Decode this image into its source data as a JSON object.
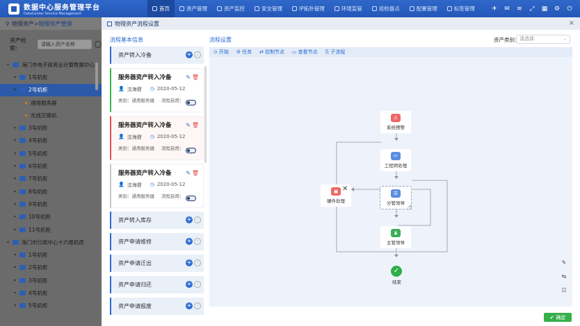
{
  "app": {
    "title": "数据中心服务管理平台",
    "subtitle": "DataCenter Service Management"
  },
  "nav": [
    {
      "label": "首页",
      "icon": "home-icon"
    },
    {
      "label": "资产管理",
      "icon": "asset-icon"
    },
    {
      "label": "资产监控",
      "icon": "monitor-icon"
    },
    {
      "label": "安全管理",
      "icon": "shield-icon"
    },
    {
      "label": "IP拓扑管理",
      "icon": "topology-icon"
    },
    {
      "label": "环境监管",
      "icon": "environment-icon"
    },
    {
      "label": "巡检盘点",
      "icon": "inspection-icon"
    },
    {
      "label": "配置管理",
      "icon": "config-icon"
    },
    {
      "label": "标签管理",
      "icon": "tag-icon"
    }
  ],
  "bg": {
    "breadcrumb": {
      "root": "物理资产",
      "sep": ">",
      "current": "物理资产管理"
    },
    "search_label": "资产检索:",
    "search_placeholder": "请输入资产名称",
    "tree": [
      {
        "label": "海门市电子政务云计算数据中心",
        "level": 0
      },
      {
        "label": "1号机柜",
        "level": 1
      },
      {
        "label": "2号机柜",
        "level": 1,
        "selected": true
      },
      {
        "label": "通用服务器",
        "level": 2
      },
      {
        "label": "光线交换机",
        "level": 2
      },
      {
        "label": "3号机柜",
        "level": 1
      },
      {
        "label": "4号机柜",
        "level": 1
      },
      {
        "label": "5号机柜",
        "level": 1
      },
      {
        "label": "6号机柜",
        "level": 1
      },
      {
        "label": "7号机柜",
        "level": 1
      },
      {
        "label": "8号机柜",
        "level": 1
      },
      {
        "label": "9号机柜",
        "level": 1
      },
      {
        "label": "10号机柜",
        "level": 1
      },
      {
        "label": "11号机柜",
        "level": 1
      },
      {
        "label": "海门市行政中心十六楼机房",
        "level": 0
      },
      {
        "label": "1号机柜",
        "level": 1
      },
      {
        "label": "2号机柜",
        "level": 1
      },
      {
        "label": "3号机柜",
        "level": 1
      },
      {
        "label": "4号机柜",
        "level": 1
      },
      {
        "label": "5号机柜",
        "level": 1
      }
    ]
  },
  "modal": {
    "title": "物理资产流程设置",
    "left_title": "流程基本信息",
    "right_title": "流程设置",
    "type_label": "资产类别：",
    "type_placeholder": "请选择",
    "confirm": "确定",
    "groups": [
      {
        "label": "资产转入冷备",
        "open": true
      },
      {
        "label": "资产转入库存"
      },
      {
        "label": "资产申请维修"
      },
      {
        "label": "资产申请迁出"
      },
      {
        "label": "资产申请归还"
      },
      {
        "label": "资产申请报废"
      }
    ],
    "cards": [
      {
        "title": "服务器资产转入冷备",
        "user": "沈海健",
        "date": "2020-05-12",
        "category": "类别：通用服务器",
        "enabled": "流程启用：",
        "variant": "green"
      },
      {
        "title": "服务器资产转入冷备",
        "user": "沈海健",
        "date": "2020-05-12",
        "category": "类别：通用服务器",
        "enabled": "流程启用：",
        "variant": "red"
      },
      {
        "title": "服务器资产转入冷备",
        "user": "沈海健",
        "date": "2020-05-12",
        "category": "类别：通用服务器",
        "enabled": "流程启用：",
        "variant": "gray"
      }
    ],
    "toolbar": [
      {
        "label": "开始",
        "icon": "play-icon"
      },
      {
        "label": "任务",
        "icon": "task-icon"
      },
      {
        "label": "控制节点",
        "icon": "control-node-icon"
      },
      {
        "label": "查看节点",
        "icon": "view-node-icon"
      },
      {
        "label": "子流程",
        "icon": "subprocess-icon"
      }
    ],
    "nodes": {
      "warn": "系统预警",
      "engineer": "工程师处理",
      "hardware": "硬件处理",
      "leader": "分管领导",
      "main_leader": "主管领导",
      "end": "结束"
    }
  }
}
